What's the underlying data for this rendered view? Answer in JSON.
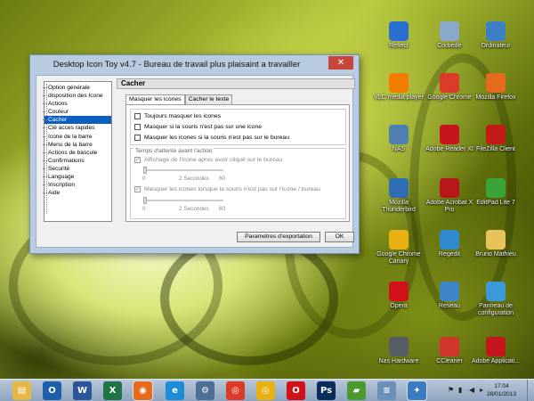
{
  "window": {
    "title": "Desktop Icon Toy v4.7 - Bureau de travail plus plaisaint a travailler",
    "close_label": "✕",
    "sidebar_items": [
      "Option générale",
      "disposition des Icone",
      "Actions",
      "Couleur",
      "Cacher",
      "Clé acces rapides",
      "Icone de la barre",
      "Menu de la barre",
      "Actions de bascule",
      "Confirmations",
      "Securité",
      "Language",
      "Inscription",
      "Aide"
    ],
    "selected_sidebar_item": "Cacher",
    "panel_title": "Cacher",
    "tabs": [
      "Masquer les icones",
      "Cacher le texte"
    ],
    "active_tab": "Masquer les icones",
    "options": [
      {
        "label": "Toujours masquer les icones",
        "checked": false
      },
      {
        "label": "Masquer si la souris n'est pas sur une icone",
        "checked": false
      },
      {
        "label": "Masquer les icones si la souris n'est pas sur le bureau",
        "checked": false
      }
    ],
    "wait_group": {
      "legend": "Temps d'attente avant l'action",
      "option1": {
        "label": "Affichage de l'icone apres avoir cliqué sur le bureau",
        "checked": true,
        "enabled": false
      },
      "slider1": {
        "min": "0",
        "mid": "2 Secondes",
        "max": "60"
      },
      "option2": {
        "label": "Masquer les icones lorsque la souris n'est pas sur l'icone / bureau",
        "checked": true,
        "enabled": false
      },
      "slider2": {
        "min": "0",
        "mid": "2 Secondes",
        "max": "60"
      }
    },
    "buttons": {
      "export": "Parametres d'exportation",
      "ok": "OK"
    }
  },
  "desktop_icons": [
    {
      "label": "Reflect",
      "icon": "reflect-icon",
      "color": "#2a6fd0"
    },
    {
      "label": "Corbeille",
      "icon": "recycle-bin-icon",
      "color": "#8aa9c8"
    },
    {
      "label": "Ordinateur",
      "icon": "computer-icon",
      "color": "#3d7fc4"
    },
    {
      "label": "VLC media player",
      "icon": "vlc-icon",
      "color": "#f07d00"
    },
    {
      "label": "Google Chrome",
      "icon": "chrome-icon",
      "color": "#dd3b2a"
    },
    {
      "label": "Mozilla Firefox",
      "icon": "firefox-icon",
      "color": "#e66a1c"
    },
    {
      "label": "NAS",
      "icon": "nas-icon",
      "color": "#4e7fb0"
    },
    {
      "label": "Adobe Reader XI",
      "icon": "adobe-reader-icon",
      "color": "#c4161c"
    },
    {
      "label": "FileZilla Client",
      "icon": "filezilla-icon",
      "color": "#c21b17"
    },
    {
      "label": "Mozilla Thunderbird",
      "icon": "thunderbird-icon",
      "color": "#2f6db5"
    },
    {
      "label": "Adobe Acrobat X Pro",
      "icon": "acrobat-icon",
      "color": "#b7161a"
    },
    {
      "label": "EditPad Lite 7",
      "icon": "editpad-icon",
      "color": "#3aa33a"
    },
    {
      "label": "Google Chrome Canary",
      "icon": "chrome-canary-icon",
      "color": "#e8b010"
    },
    {
      "label": "Regedit",
      "icon": "regedit-icon",
      "color": "#2f8ad0"
    },
    {
      "label": "Bruno Mathieu",
      "icon": "user-folder-icon",
      "color": "#e8c25a"
    },
    {
      "label": "Opera",
      "icon": "opera-icon",
      "color": "#d1121a"
    },
    {
      "label": "Reseau",
      "icon": "network-icon",
      "color": "#3f86c8"
    },
    {
      "label": "Panneau de configuration",
      "icon": "control-panel-icon",
      "color": "#3b9ad8"
    },
    {
      "label": "Nas Hardware",
      "icon": "nas-hardware-icon",
      "color": "#555e66"
    },
    {
      "label": "CCleaner",
      "icon": "ccleaner-icon",
      "color": "#d0362b"
    },
    {
      "label": "Adobe Applicati...",
      "icon": "adobe-app-icon",
      "color": "#c4161c"
    }
  ],
  "taskbar": {
    "apps": [
      {
        "name": "explorer-icon",
        "color": "#e5b743",
        "glyph": "▤"
      },
      {
        "name": "outlook-icon",
        "color": "#1f5fa9",
        "glyph": "O"
      },
      {
        "name": "word-icon",
        "color": "#2b579a",
        "glyph": "W"
      },
      {
        "name": "excel-icon",
        "color": "#217346",
        "glyph": "X"
      },
      {
        "name": "firefox-icon",
        "color": "#e66a1c",
        "glyph": "◉"
      },
      {
        "name": "internet-explorer-icon",
        "color": "#1e8bd6",
        "glyph": "e"
      },
      {
        "name": "network-tool-icon",
        "color": "#4b6f96",
        "glyph": "⚙"
      },
      {
        "name": "chrome-icon",
        "color": "#dd3b2a",
        "glyph": "◎"
      },
      {
        "name": "chrome-canary-icon",
        "color": "#e8b010",
        "glyph": "◎"
      },
      {
        "name": "opera-icon",
        "color": "#d1121a",
        "glyph": "O"
      },
      {
        "name": "photoshop-icon",
        "color": "#0a2c5a",
        "glyph": "Ps"
      },
      {
        "name": "evernote-icon",
        "color": "#4a9a30",
        "glyph": "▰"
      },
      {
        "name": "notepad-icon",
        "color": "#6a8fb8",
        "glyph": "≡"
      },
      {
        "name": "desktop-icon-toy-icon",
        "color": "#3b7bc0",
        "glyph": "✦"
      }
    ],
    "time": "17:04",
    "date": "28/01/2013"
  }
}
